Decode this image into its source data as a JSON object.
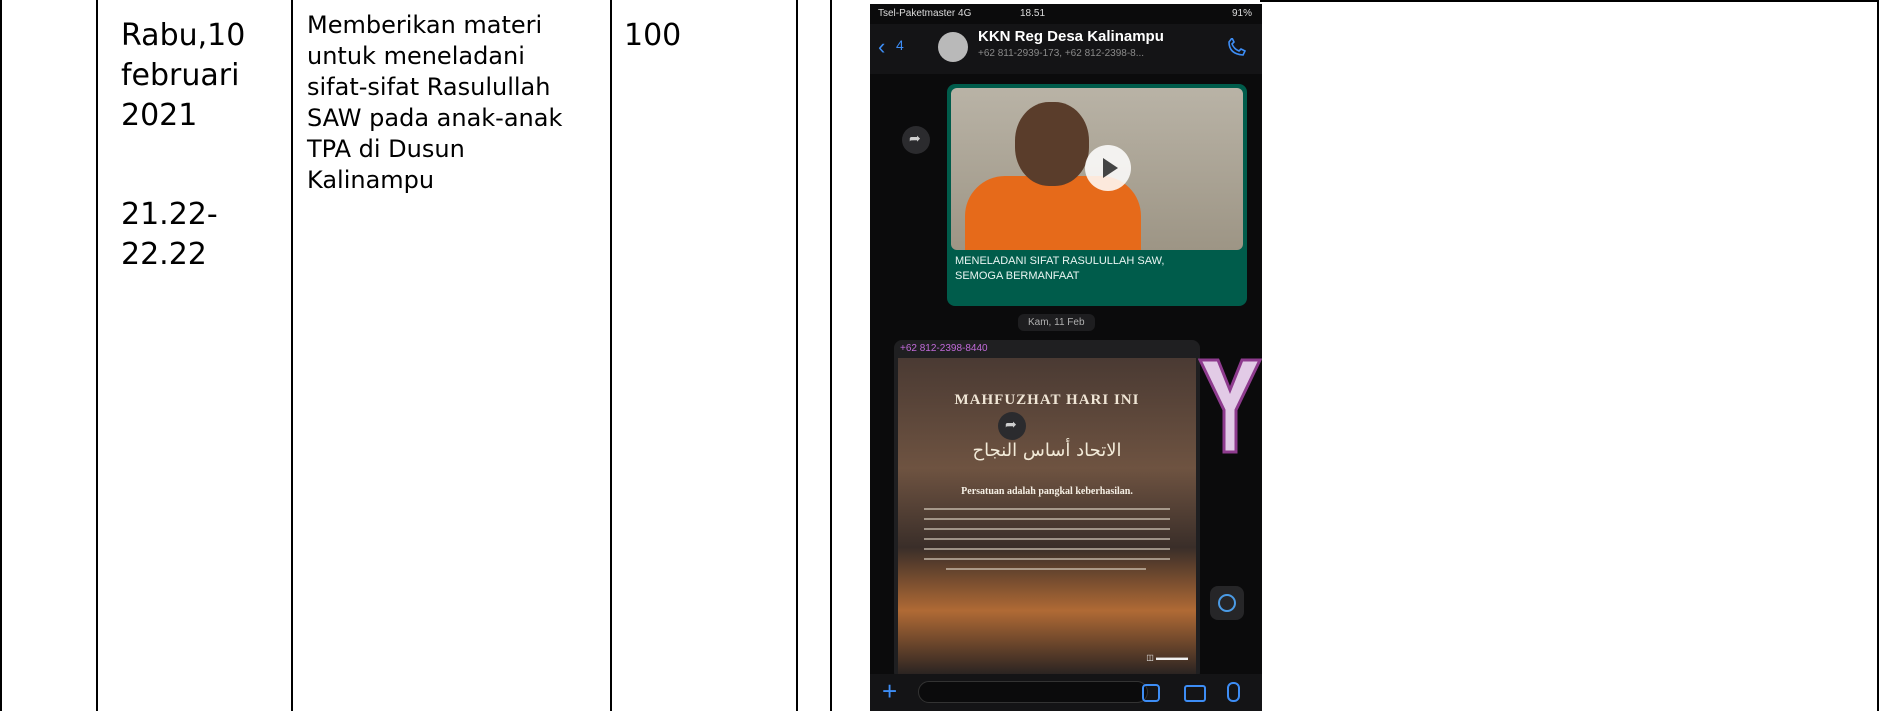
{
  "table": {
    "date": "Rabu,10 februari 2021",
    "date_lines": [
      "Rabu,10",
      "februari",
      "2021"
    ],
    "time_lines": [
      "21.22-",
      "22.22"
    ],
    "activity_lines": [
      "Memberikan materi",
      "untuk meneladani",
      "sifat-sifat Rasulullah",
      "SAW pada anak-anak",
      "TPA di Dusun",
      "Kalinampu"
    ],
    "score": "100"
  },
  "phone": {
    "status": {
      "carrier": "Tsel-Paketmaster 4G",
      "time": "18.51",
      "battery": "91%"
    },
    "header": {
      "back_count": "4",
      "group_name": "KKN Reg Desa Kalinampu",
      "members": "+62 811-2939-173, +62 812-2398-8..."
    },
    "video_caption_lines": [
      "MENELADANI SIFAT RASULULLAH SAW,",
      "SEMOGA BERMANFAAT"
    ],
    "date_chip": "Kam, 11 Feb",
    "image_message": {
      "sender": "+62 812-2398-8440",
      "poster_title": "MAHFUZHAT HARI INI",
      "poster_arabic": "الاتحاد أساس النجاح",
      "poster_subtitle": "Persatuan adalah pangkal keberhasilan."
    }
  },
  "colors": {
    "grid": "#000000",
    "whatsapp_bubble": "#005c4b",
    "ios_accent": "#3d8df5"
  }
}
